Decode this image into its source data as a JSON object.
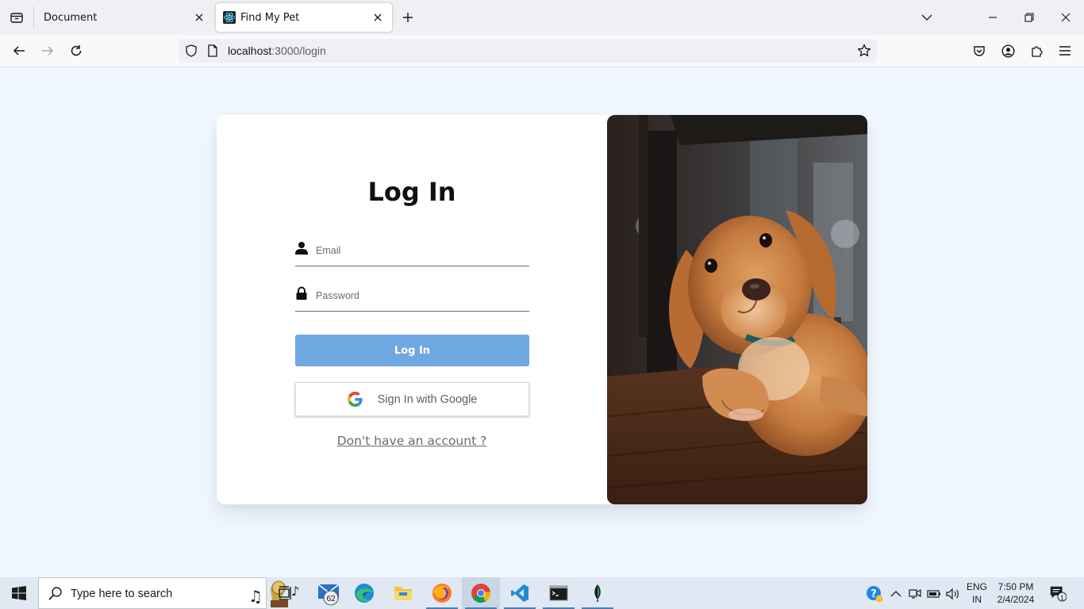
{
  "browser": {
    "tabs": [
      {
        "title": "Document",
        "active": false
      },
      {
        "title": "Find My Pet",
        "active": true
      }
    ],
    "url": {
      "host": "localhost",
      "path": ":3000/login"
    }
  },
  "login": {
    "title": "Log In",
    "email_placeholder": "Email",
    "password_placeholder": "Password",
    "login_button": "Log In",
    "google_button": "Sign In with Google",
    "signup_link": "Don't have an account ?"
  },
  "image": {
    "alt": "puppy-photo"
  },
  "taskbar": {
    "search_placeholder": "Type here to search",
    "mail_badge": "62",
    "language": {
      "line1": "ENG",
      "line2": "IN"
    },
    "clock": {
      "time": "7:50 PM",
      "date": "2/4/2024"
    },
    "notification_count": "1"
  },
  "colors": {
    "page_bg": "#f0f7ff",
    "login_button": "#6fa8e1",
    "taskbar": "#dfe8f3"
  }
}
